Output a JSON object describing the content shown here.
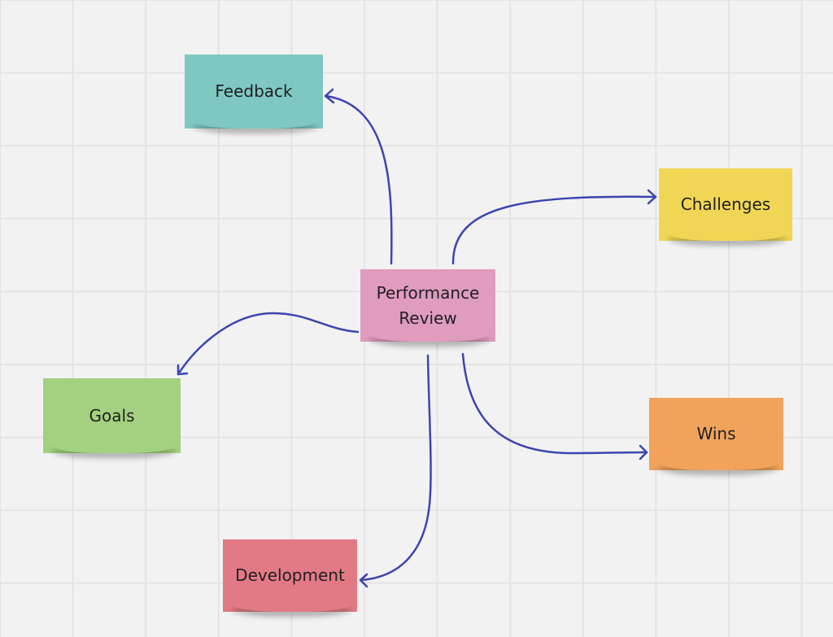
{
  "board": {
    "type": "mind-map",
    "central_topic": "Performance Review"
  },
  "notes": {
    "center": {
      "label": "Performance Review",
      "line1": "Performance",
      "line2": "Review",
      "color": "#df9cbf"
    },
    "feedback": {
      "label": "Feedback",
      "color": "#7fc8c2"
    },
    "challenges": {
      "label": "Challenges",
      "color": "#f1d655"
    },
    "wins": {
      "label": "Wins",
      "color": "#f1a35b"
    },
    "goals": {
      "label": "Goals",
      "color": "#a3d17f"
    },
    "development": {
      "label": "Development",
      "color": "#e27a86"
    }
  },
  "connectors": {
    "color": "#3c45b0",
    "edges": [
      {
        "from": "Performance Review",
        "to": "Feedback"
      },
      {
        "from": "Performance Review",
        "to": "Challenges"
      },
      {
        "from": "Performance Review",
        "to": "Goals"
      },
      {
        "from": "Performance Review",
        "to": "Development"
      },
      {
        "from": "Performance Review",
        "to": "Wins"
      }
    ]
  }
}
